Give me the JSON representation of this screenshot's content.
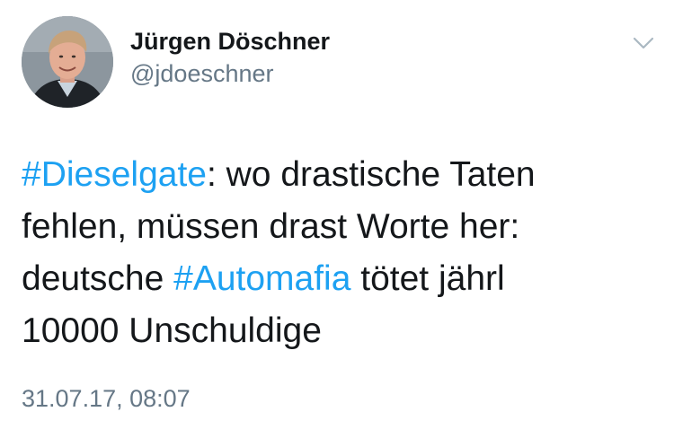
{
  "tweet": {
    "author": {
      "display_name": "Jürgen Döschner",
      "handle": "@jdoeschner"
    },
    "menu_icon": "chevron-down-icon",
    "text": {
      "line1": {
        "hashtag": "#Dieselgate",
        "rest": ": wo drastische Taten"
      },
      "line2": "fehlen, müssen drast Worte her:",
      "line3": {
        "before": "deutsche ",
        "hashtag": "#Automafia",
        "after": " tötet jährl"
      },
      "line4": "10000 Unschuldige"
    },
    "timestamp": "31.07.17, 08:07"
  },
  "colors": {
    "hashtag": "#1da1f2",
    "secondary_text": "#657786",
    "primary_text": "#14171a"
  }
}
